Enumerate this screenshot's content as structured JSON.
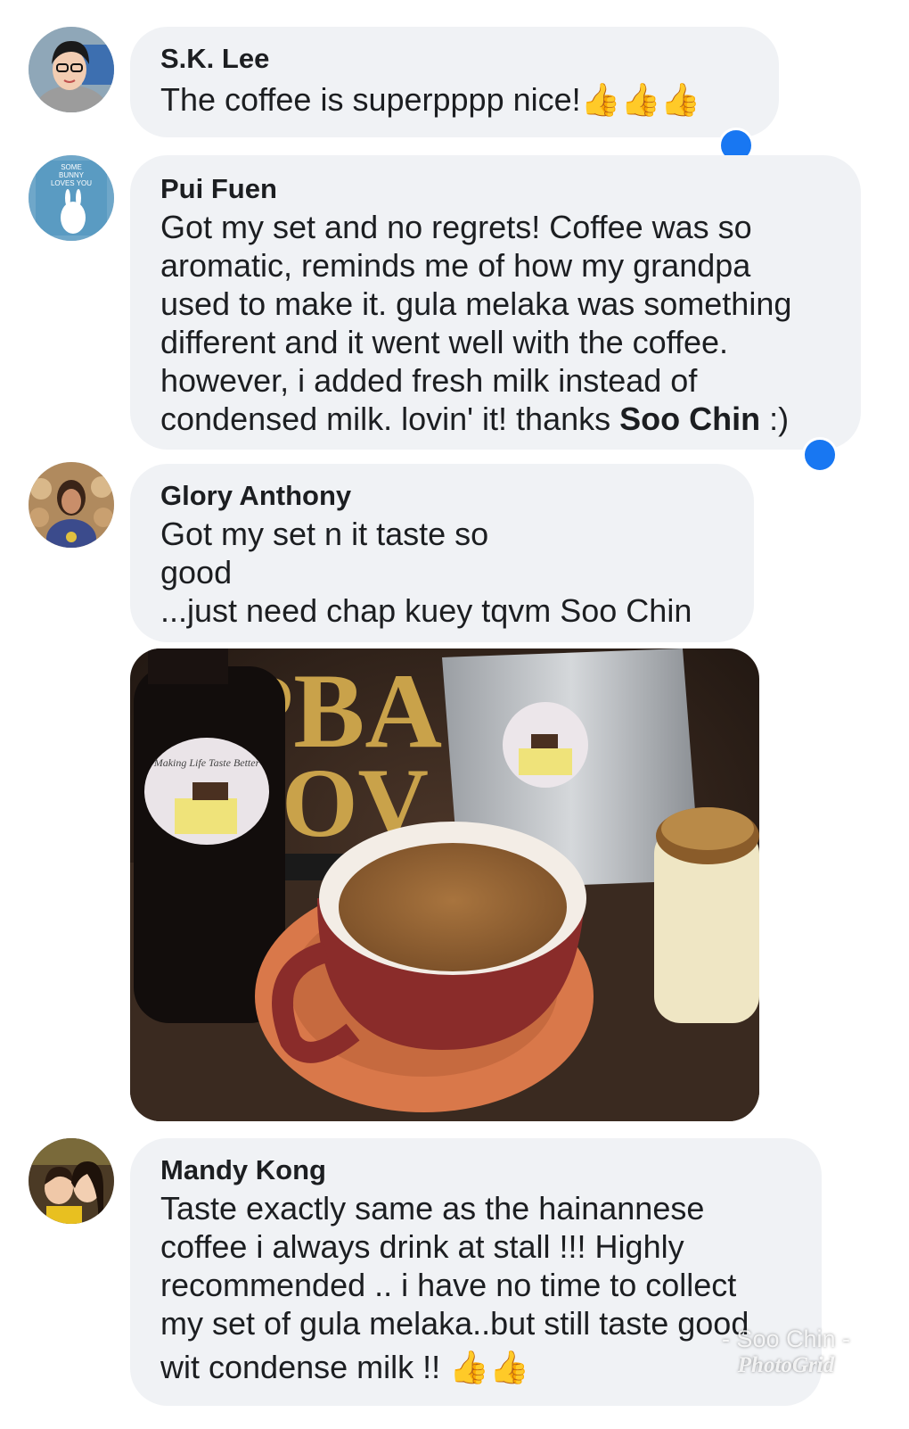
{
  "comments": [
    {
      "author": "S.K. Lee",
      "text": "The coffee is superpppp nice!",
      "reaction": "thumbs-up x3"
    },
    {
      "author": "Pui Fuen",
      "lines": [
        "Got my set and no regrets! Coffee was so",
        "aromatic, reminds me of how my grandpa",
        "used to make it. gula melaka was something",
        "different and it went well with the coffee.",
        "however, i added fresh milk instead of"
      ],
      "last_line_prefix": "condensed milk. lovin' it! thanks ",
      "mention": "Soo Chin",
      "last_line_suffix": " :)"
    },
    {
      "author": "Glory Anthony",
      "lines": [
        "Got my set n it taste so",
        "good",
        "...just need chap kuey tqvm Soo Chin"
      ]
    },
    {
      "author": "Mandy Kong",
      "lines": [
        "Taste exactly same as the hainannese",
        "coffee i always drink at stall !!! Highly",
        "recommended .. i have no time to collect",
        "my set of gula melaka..but still taste good",
        "wit condense milk !! "
      ]
    }
  ],
  "watermark": {
    "line1": "- Soo Chin -",
    "line2": "PhotoGrid"
  },
  "photo_alt": "photo-attachment",
  "colors": {
    "bubble": "#f0f2f5",
    "like_blue": "#1877f2",
    "text": "#1c1e21"
  }
}
